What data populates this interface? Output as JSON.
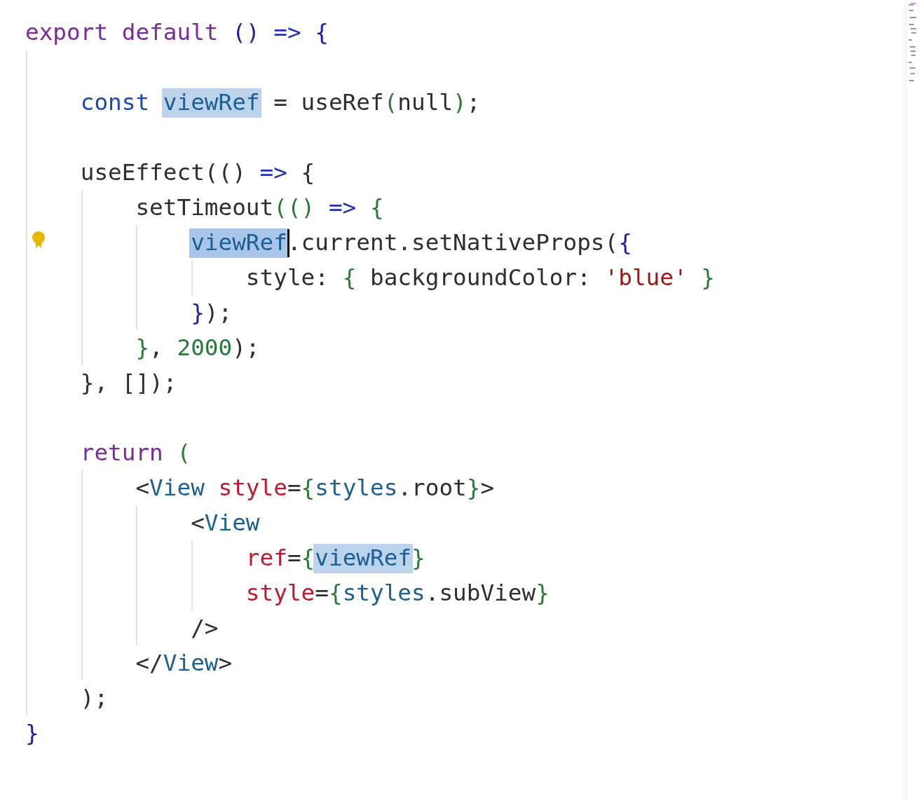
{
  "lines": [
    {
      "lightbulb": false,
      "tokens": [
        {
          "text": "export default ",
          "kind": "keyword",
          "highlighted": false,
          "caret": false
        },
        {
          "text": "() ",
          "kind": "paren",
          "highlighted": false,
          "caret": false
        },
        {
          "text": "=> ",
          "kind": "op",
          "highlighted": false,
          "caret": false
        },
        {
          "text": "{",
          "kind": "paren",
          "highlighted": false,
          "caret": false
        }
      ]
    },
    {
      "lightbulb": false
    },
    {
      "lightbulb": false,
      "tokens": [
        {
          "text": "    const ",
          "kind": "storage",
          "highlighted": false,
          "caret": false
        },
        {
          "text": "viewRef",
          "kind": "ident",
          "highlighted": true,
          "caret": false
        },
        {
          "text": " = useRef",
          "kind": "plain",
          "highlighted": false,
          "caret": false
        },
        {
          "text": "(",
          "kind": "green",
          "highlighted": false,
          "caret": false
        },
        {
          "text": "null",
          "kind": "plain",
          "highlighted": false,
          "caret": false
        },
        {
          "text": ")",
          "kind": "green",
          "highlighted": false,
          "caret": false
        },
        {
          "text": ";",
          "kind": "plain",
          "highlighted": false,
          "caret": false
        }
      ]
    },
    {
      "lightbulb": false
    },
    {
      "lightbulb": false,
      "tokens": [
        {
          "text": "    useEffect(() ",
          "kind": "plain",
          "highlighted": false,
          "caret": false
        },
        {
          "text": "=> ",
          "kind": "op",
          "highlighted": false,
          "caret": false
        },
        {
          "text": "{",
          "kind": "plain",
          "highlighted": false,
          "caret": false
        }
      ]
    },
    {
      "lightbulb": false,
      "tokens": [
        {
          "text": "        setTimeout",
          "kind": "plain",
          "highlighted": false,
          "caret": false
        },
        {
          "text": "(() ",
          "kind": "green",
          "highlighted": false,
          "caret": false
        },
        {
          "text": "=> ",
          "kind": "op",
          "highlighted": false,
          "caret": false
        },
        {
          "text": "{",
          "kind": "green",
          "highlighted": false,
          "caret": false
        }
      ]
    },
    {
      "lightbulb": true,
      "tokens": [
        {
          "text": "            viewRef",
          "kind": "ident",
          "highlighted": true,
          "caret": true
        },
        {
          "text": ".current.setNativeProps(",
          "kind": "plain",
          "highlighted": false,
          "caret": false
        },
        {
          "text": "{",
          "kind": "paren",
          "highlighted": false,
          "caret": false
        }
      ]
    },
    {
      "lightbulb": false,
      "tokens": [
        {
          "text": "                style: ",
          "kind": "plain",
          "highlighted": false,
          "caret": false
        },
        {
          "text": "{ ",
          "kind": "green",
          "highlighted": false,
          "caret": false
        },
        {
          "text": "backgroundColor: ",
          "kind": "plain",
          "highlighted": false,
          "caret": false
        },
        {
          "text": "'blue'",
          "kind": "string",
          "highlighted": false,
          "caret": false
        },
        {
          "text": " }",
          "kind": "green",
          "highlighted": false,
          "caret": false
        }
      ]
    },
    {
      "lightbulb": false,
      "tokens": [
        {
          "text": "            }",
          "kind": "paren",
          "highlighted": false,
          "caret": false
        },
        {
          "text": ");",
          "kind": "plain",
          "highlighted": false,
          "caret": false
        }
      ]
    },
    {
      "lightbulb": false,
      "tokens": [
        {
          "text": "        }",
          "kind": "green",
          "highlighted": false,
          "caret": false
        },
        {
          "text": ", ",
          "kind": "plain",
          "highlighted": false,
          "caret": false
        },
        {
          "text": "2000",
          "kind": "green",
          "highlighted": false,
          "caret": false
        },
        {
          "text": ");",
          "kind": "plain",
          "highlighted": false,
          "caret": false
        }
      ]
    },
    {
      "lightbulb": false,
      "tokens": [
        {
          "text": "    }, []);",
          "kind": "plain",
          "highlighted": false,
          "caret": false
        }
      ]
    },
    {
      "lightbulb": false
    },
    {
      "lightbulb": false,
      "tokens": [
        {
          "text": "    return ",
          "kind": "keyword",
          "highlighted": false,
          "caret": false
        },
        {
          "text": "(",
          "kind": "green",
          "highlighted": false,
          "caret": false
        }
      ]
    },
    {
      "lightbulb": false,
      "tokens": [
        {
          "text": "        <",
          "kind": "plain",
          "highlighted": false,
          "caret": false
        },
        {
          "text": "View ",
          "kind": "ident",
          "highlighted": false,
          "caret": false
        },
        {
          "text": "style",
          "kind": "attr",
          "highlighted": false,
          "caret": false
        },
        {
          "text": "=",
          "kind": "plain",
          "highlighted": false,
          "caret": false
        },
        {
          "text": "{",
          "kind": "green",
          "highlighted": false,
          "caret": false
        },
        {
          "text": "styles",
          "kind": "ident",
          "highlighted": false,
          "caret": false
        },
        {
          "text": ".root",
          "kind": "plain",
          "highlighted": false,
          "caret": false
        },
        {
          "text": "}",
          "kind": "green",
          "highlighted": false,
          "caret": false
        },
        {
          "text": ">",
          "kind": "plain",
          "highlighted": false,
          "caret": false
        }
      ]
    },
    {
      "lightbulb": false,
      "tokens": [
        {
          "text": "            <",
          "kind": "plain",
          "highlighted": false,
          "caret": false
        },
        {
          "text": "View",
          "kind": "ident",
          "highlighted": false,
          "caret": false
        }
      ]
    },
    {
      "lightbulb": false,
      "tokens": [
        {
          "text": "                ref",
          "kind": "attr",
          "highlighted": false,
          "caret": false
        },
        {
          "text": "=",
          "kind": "plain",
          "highlighted": false,
          "caret": false
        },
        {
          "text": "{",
          "kind": "green",
          "highlighted": false,
          "caret": false
        },
        {
          "text": "viewRef",
          "kind": "ident",
          "highlighted": true,
          "caret": false
        },
        {
          "text": "}",
          "kind": "green",
          "highlighted": false,
          "caret": false
        }
      ]
    },
    {
      "lightbulb": false,
      "tokens": [
        {
          "text": "                style",
          "kind": "attr",
          "highlighted": false,
          "caret": false
        },
        {
          "text": "=",
          "kind": "plain",
          "highlighted": false,
          "caret": false
        },
        {
          "text": "{",
          "kind": "green",
          "highlighted": false,
          "caret": false
        },
        {
          "text": "styles",
          "kind": "ident",
          "highlighted": false,
          "caret": false
        },
        {
          "text": ".subView",
          "kind": "plain",
          "highlighted": false,
          "caret": false
        },
        {
          "text": "}",
          "kind": "green",
          "highlighted": false,
          "caret": false
        }
      ]
    },
    {
      "lightbulb": false,
      "tokens": [
        {
          "text": "            />",
          "kind": "plain",
          "highlighted": false,
          "caret": false
        }
      ]
    },
    {
      "lightbulb": false,
      "tokens": [
        {
          "text": "        </",
          "kind": "plain",
          "highlighted": false,
          "caret": false
        },
        {
          "text": "View",
          "kind": "ident",
          "highlighted": false,
          "caret": false
        },
        {
          "text": ">",
          "kind": "plain",
          "highlighted": false,
          "caret": false
        }
      ]
    },
    {
      "lightbulb": false,
      "tokens": [
        {
          "text": "    );",
          "kind": "plain",
          "highlighted": false,
          "caret": false
        }
      ]
    },
    {
      "lightbulb": false,
      "tokens": [
        {
          "text": "}",
          "kind": "paren",
          "highlighted": false,
          "caret": false
        }
      ]
    }
  ]
}
